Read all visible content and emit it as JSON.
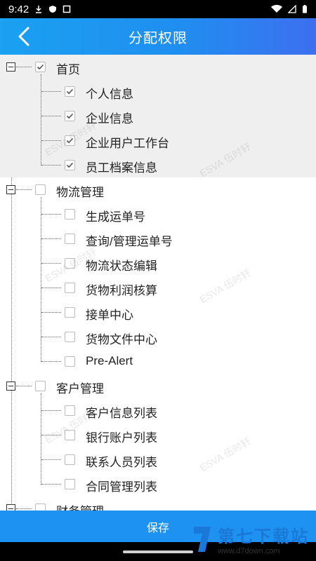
{
  "status_bar": {
    "time": "9:42"
  },
  "header": {
    "title": "分配权限"
  },
  "tree": [
    {
      "label": "首页",
      "checked": true,
      "children": [
        {
          "label": "个人信息",
          "checked": true
        },
        {
          "label": "企业信息",
          "checked": true
        },
        {
          "label": "企业用户工作台",
          "checked": true
        },
        {
          "label": "员工档案信息",
          "checked": true
        }
      ]
    },
    {
      "label": "物流管理",
      "checked": false,
      "children": [
        {
          "label": "生成运单号",
          "checked": false
        },
        {
          "label": "查询/管理运单号",
          "checked": false
        },
        {
          "label": "物流状态编辑",
          "checked": false
        },
        {
          "label": "货物利润核算",
          "checked": false
        },
        {
          "label": "接单中心",
          "checked": false
        },
        {
          "label": "货物文件中心",
          "checked": false
        },
        {
          "label": "Pre-Alert",
          "checked": false
        }
      ]
    },
    {
      "label": "客户管理",
      "checked": false,
      "children": [
        {
          "label": "客户信息列表",
          "checked": false
        },
        {
          "label": "银行账户列表",
          "checked": false
        },
        {
          "label": "联系人员列表",
          "checked": false
        },
        {
          "label": "合同管理列表",
          "checked": false
        }
      ]
    },
    {
      "label": "财务管理",
      "checked": false,
      "children": []
    }
  ],
  "watermark": "ESVA 伍时轩",
  "save_label": "保存",
  "brand": {
    "name": "第七下载站",
    "url": "www.d7down.com"
  },
  "colors": {
    "accent": "#1d92f1",
    "group_bg": "#efefef"
  }
}
